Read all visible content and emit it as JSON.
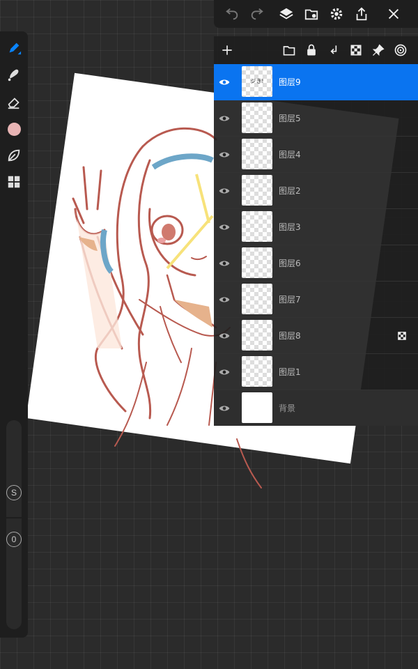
{
  "top_toolbar": {
    "buttons": [
      "undo-icon",
      "redo-icon",
      "layers-icon",
      "import-icon",
      "settings-icon",
      "share-icon",
      "close-icon"
    ]
  },
  "left_toolbar": {
    "tools": [
      "pen-icon",
      "smudge-icon",
      "eraser-icon",
      "color-swatch",
      "leaf-icon",
      "grid-icon"
    ],
    "active_color": "#e8b4b4",
    "accent": "#0a84ff",
    "brush_size_label": "S",
    "opacity_label": "0"
  },
  "layers_panel": {
    "header_buttons": [
      "add-layer-icon",
      "folder-icon",
      "lock-icon",
      "merge-down-icon",
      "transparency-icon",
      "pin-icon",
      "more-icon"
    ],
    "layers": [
      {
        "name": "图层9",
        "selected": true,
        "thumb_text": "ジき!"
      },
      {
        "name": "图层5",
        "selected": false
      },
      {
        "name": "图层4",
        "selected": false
      },
      {
        "name": "图层2",
        "selected": false
      },
      {
        "name": "图层3",
        "selected": false
      },
      {
        "name": "图层6",
        "selected": false
      },
      {
        "name": "图层7",
        "selected": false
      },
      {
        "name": "图层8",
        "selected": false,
        "badge": "transparency-icon"
      },
      {
        "name": "图层1",
        "selected": false
      },
      {
        "name": "背景",
        "selected": false,
        "is_background": true
      }
    ],
    "selected_color": "#0a74f0"
  }
}
